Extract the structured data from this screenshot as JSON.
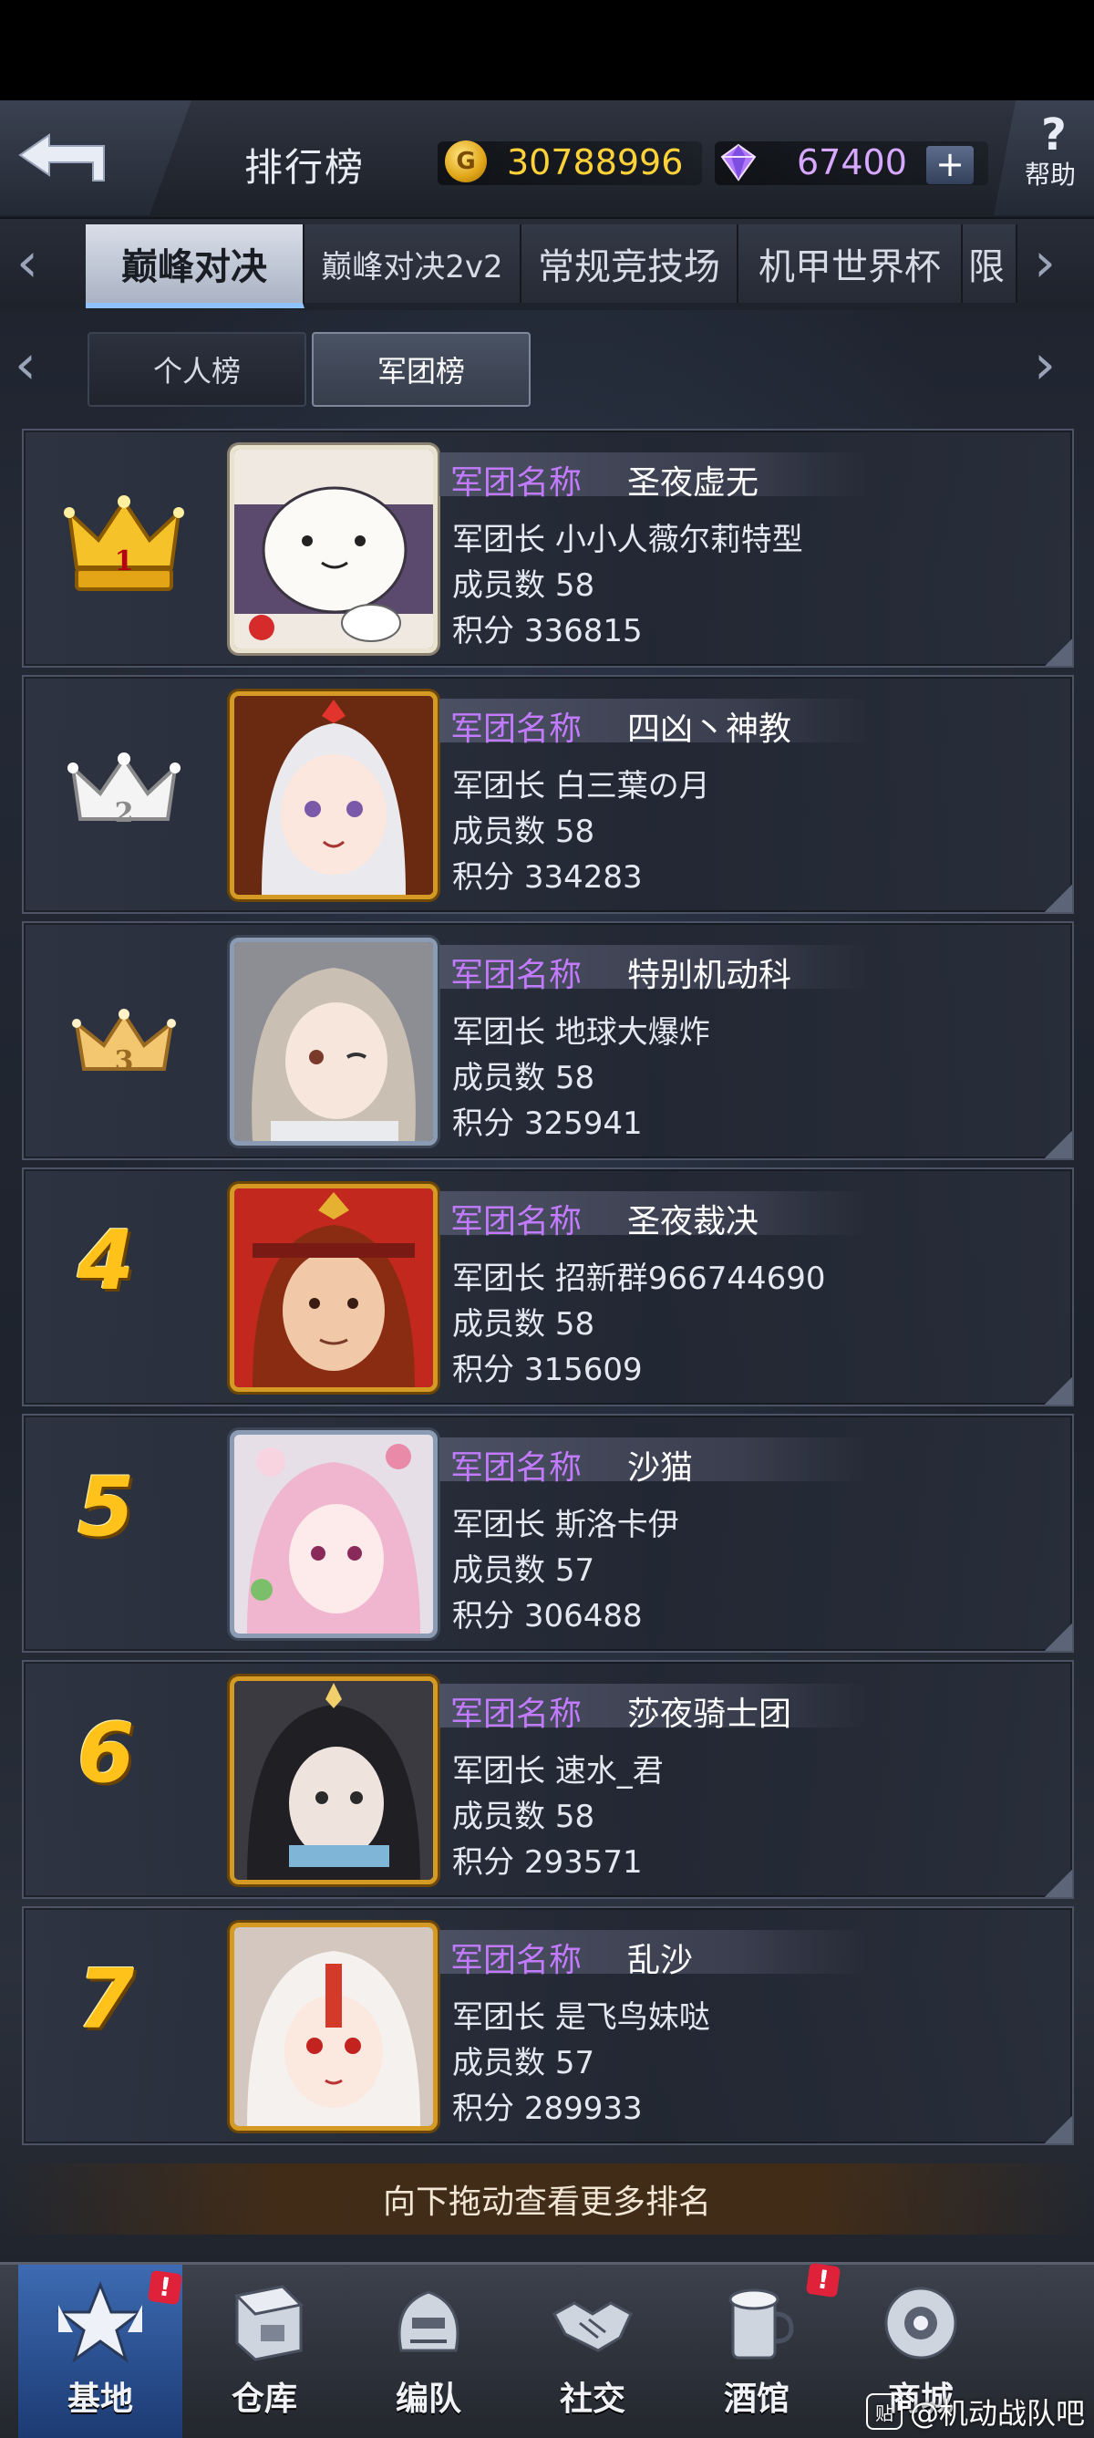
{
  "header": {
    "title": "排行榜",
    "coins": "30788996",
    "gems": "67400",
    "help_label": "帮助",
    "help_glyph": "?",
    "plus_glyph": "+"
  },
  "mode_tabs": [
    "巅峰对决",
    "巅峰对决2v2",
    "常规竞技场",
    "机甲世界杯",
    "限"
  ],
  "active_mode_tab": "巅峰对决",
  "sub_tabs": [
    "个人榜",
    "军团榜"
  ],
  "active_sub_tab": "军团榜",
  "field_labels": {
    "name": "军团名称",
    "leader": "军团长",
    "members": "成员数",
    "score": "积分"
  },
  "rankings": [
    {
      "rank": "1",
      "name": "圣夜虚无",
      "leader": "小小人薇尔莉特型",
      "members": "58",
      "score": "336815"
    },
    {
      "rank": "2",
      "name": "四凶丶神教",
      "leader": "白三葉の月",
      "members": "58",
      "score": "334283"
    },
    {
      "rank": "3",
      "name": "特别机动科",
      "leader": "地球大爆炸",
      "members": "58",
      "score": "325941"
    },
    {
      "rank": "4",
      "name": "圣夜裁决",
      "leader": "招新群966744690",
      "members": "58",
      "score": "315609"
    },
    {
      "rank": "5",
      "name": "沙猫",
      "leader": "斯洛卡伊",
      "members": "57",
      "score": "306488"
    },
    {
      "rank": "6",
      "name": "莎夜骑士团",
      "leader": "速水_君",
      "members": "58",
      "score": "293571"
    },
    {
      "rank": "7",
      "name": "乱沙",
      "leader": "是飞鸟妹哒",
      "members": "57",
      "score": "289933"
    }
  ],
  "hint": "向下拖动查看更多排名",
  "bottom_nav": [
    {
      "label": "基地",
      "icon": "base-icon",
      "alert": "!"
    },
    {
      "label": "仓库",
      "icon": "warehouse-icon"
    },
    {
      "label": "编队",
      "icon": "formation-icon"
    },
    {
      "label": "社交",
      "icon": "social-icon"
    },
    {
      "label": "酒馆",
      "icon": "tavern-icon",
      "alert": "!"
    },
    {
      "label": "商城",
      "icon": "shop-icon"
    }
  ],
  "watermark": {
    "logo": "贴",
    "text": "@机动战队吧"
  },
  "colors": {
    "gold": "#ffc21a",
    "name_label": "#c27bff",
    "coin_text": "#ffd23a",
    "gem_text": "#d7a8ff",
    "active_nav": "#3d6bb3",
    "alert": "#e0213a"
  }
}
